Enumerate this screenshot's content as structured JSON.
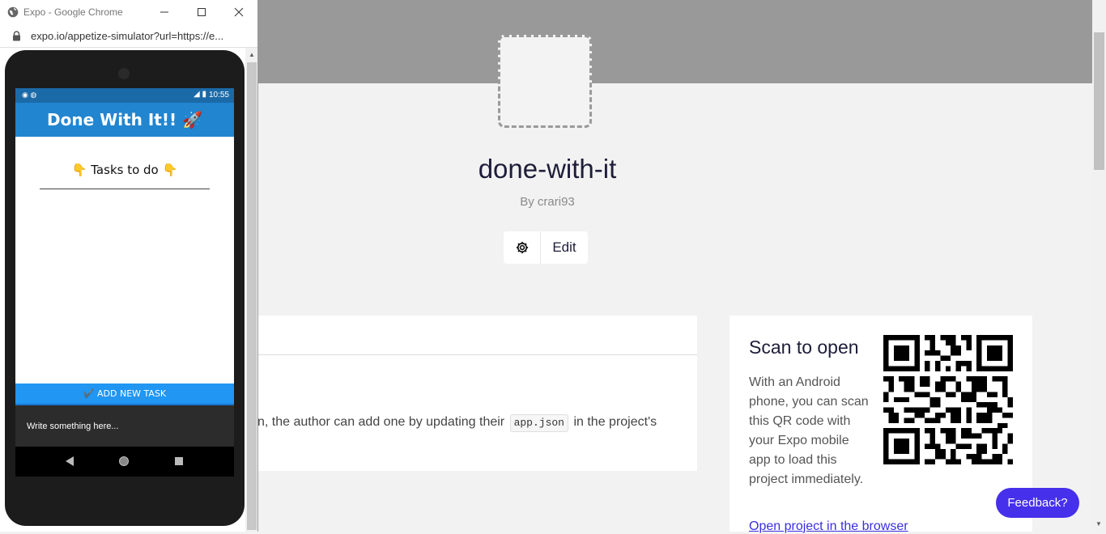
{
  "browser": {
    "window_title": "Expo - Google Chrome",
    "url": "expo.io/appetize-simulator?url=https://e...",
    "window_controls": [
      "minimize",
      "maximize",
      "close"
    ]
  },
  "simulator": {
    "status_time": "10:55",
    "app_title": "Done With It!! 🚀",
    "tasks_heading": "👇 Tasks to do 👇",
    "add_button_label": "✔️ ADD NEW TASK",
    "input_placeholder": "Write something here...",
    "nav_icons": [
      "back-icon",
      "home-icon",
      "recents-icon"
    ]
  },
  "project": {
    "name": "done-with-it",
    "byline": "By crari93",
    "edit_label": "Edit",
    "description_before": "n, the author can add one by updating their",
    "description_code": "app.json",
    "description_after": "in the project's"
  },
  "scan": {
    "title": "Scan to open",
    "text": "With an Android phone, you can scan this QR code with your Expo mobile app to load this project immediately.",
    "link": "Open project in the browser"
  },
  "feedback": {
    "label": "Feedback?"
  },
  "colors": {
    "accent": "#4630eb",
    "expo_blue": "#2196f3",
    "header_blue": "#2185d0"
  }
}
